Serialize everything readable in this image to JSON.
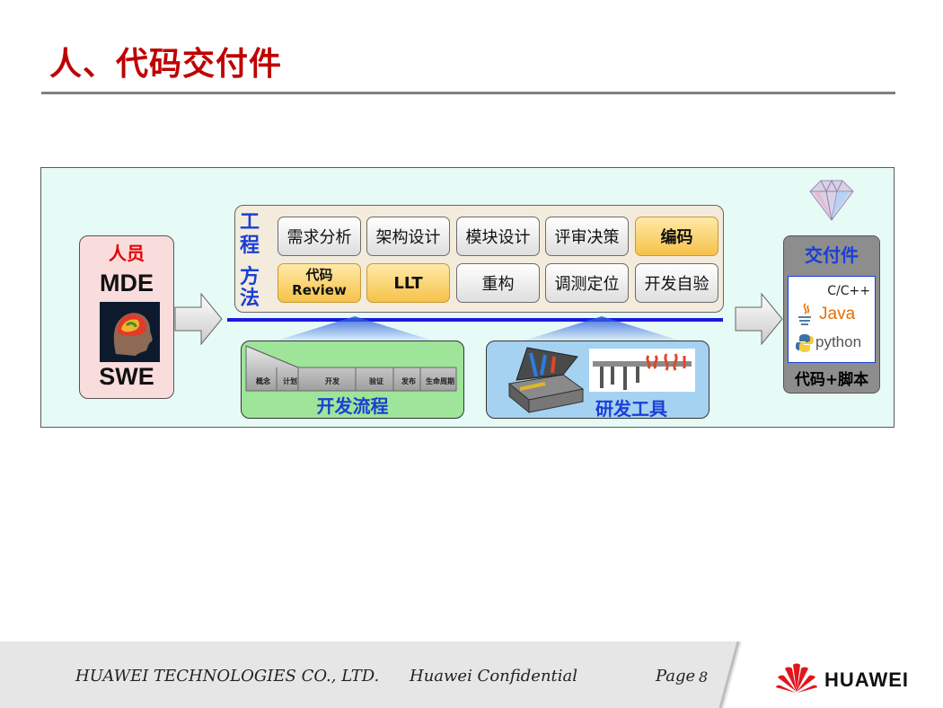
{
  "title": "人、代码交付件",
  "people": {
    "title": "人员",
    "mde": "MDE",
    "swe": "SWE"
  },
  "methods": {
    "vertical_label": [
      "工",
      "程",
      "方",
      "法"
    ],
    "row1": [
      "需求分析",
      "架构设计",
      "模块设计",
      "评审决策",
      "编码"
    ],
    "row2": [
      "代码",
      "Review",
      "LLT",
      "重构",
      "调测定位",
      "开发自验"
    ]
  },
  "deliverables": {
    "title": "交付件",
    "languages": [
      "C/C++",
      "Java",
      "python"
    ],
    "footer": "代码+脚本"
  },
  "process": {
    "label": "开发流程",
    "stages": [
      "概念",
      "计划",
      "开发",
      "验证",
      "发布",
      "生命周期"
    ]
  },
  "tools": {
    "label": "研发工具"
  },
  "footer": {
    "company": "HUAWEI TECHNOLOGIES CO., LTD.",
    "confidential": "Huawei Confidential",
    "page_label": "Page",
    "page_number": "8",
    "brand": "HUAWEI"
  },
  "colors": {
    "title_red": "#c00000",
    "method_blue": "#1a3fd6",
    "gold": "#f6c24a"
  }
}
